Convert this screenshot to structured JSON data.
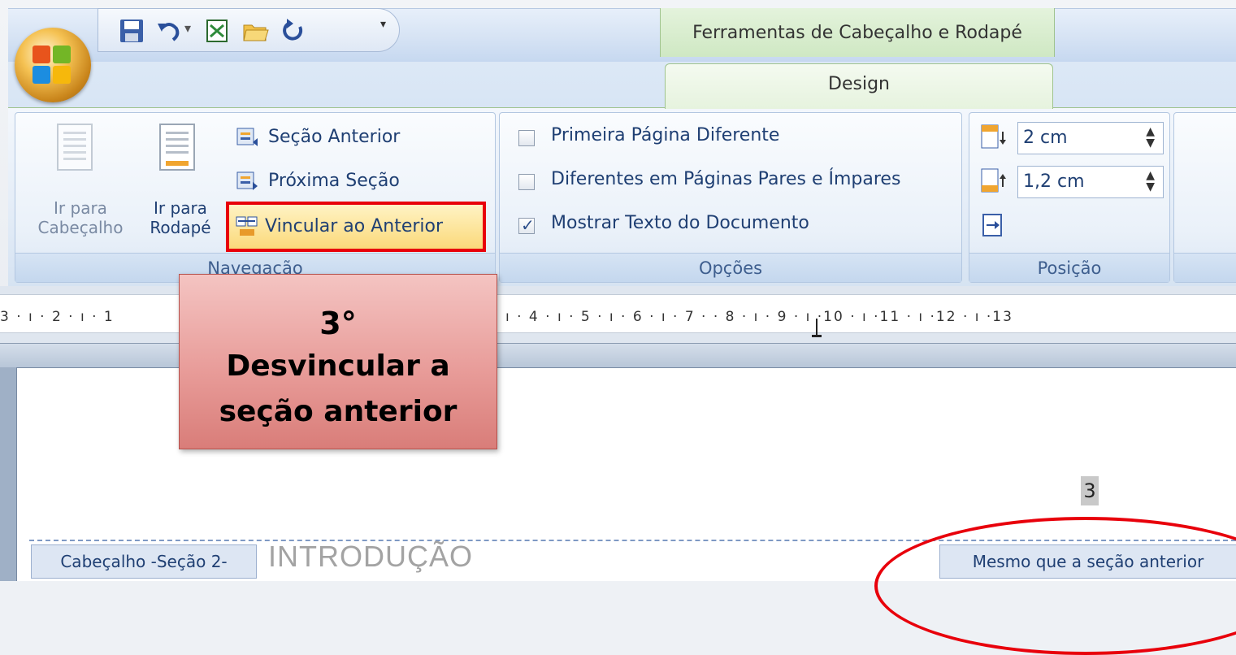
{
  "context_tab": {
    "group_title": "Ferramentas de Cabeçalho e Rodapé",
    "tab_label": "Design"
  },
  "navigation": {
    "goto_header_line1": "Ir para",
    "goto_header_line2": "Cabeçalho",
    "goto_footer_line1": "Ir para",
    "goto_footer_line2": "Rodapé",
    "previous_section": "Seção Anterior",
    "next_section": "Próxima Seção",
    "link_to_previous": "Vincular ao Anterior",
    "group_label": "Navegação"
  },
  "options": {
    "different_first_page": {
      "label": "Primeira Página Diferente",
      "checked": false
    },
    "different_odd_even": {
      "label": "Diferentes em Páginas Pares e Ímpares",
      "checked": false
    },
    "show_document_text": {
      "label": "Mostrar Texto do Documento",
      "checked": true
    },
    "group_label": "Opções"
  },
  "position": {
    "header_from_top": "2 cm",
    "footer_from_bottom": "1,2 cm",
    "group_label": "Posição"
  },
  "ruler": {
    "left_text": "3 · ı · 2 · ı · 1",
    "right_text": "ı · 4 · ı · 5 · ı · 6 · ı · 7 ·   · 8 · ı · 9 · ı ·10 · ı ·11 · ı ·12 · ı ·13"
  },
  "document": {
    "header_tag": "Cabeçalho -Seção 2-",
    "header_text": "INTRODUÇÃO",
    "same_as_previous_tag": "Mesmo que a seção anterior",
    "page_number": "3"
  },
  "callout": {
    "step": "3°",
    "line1": "Desvincular a",
    "line2": "seção anterior"
  },
  "colors": {
    "highlight_border": "#e8000b",
    "callout_fill": "#e89c99"
  }
}
